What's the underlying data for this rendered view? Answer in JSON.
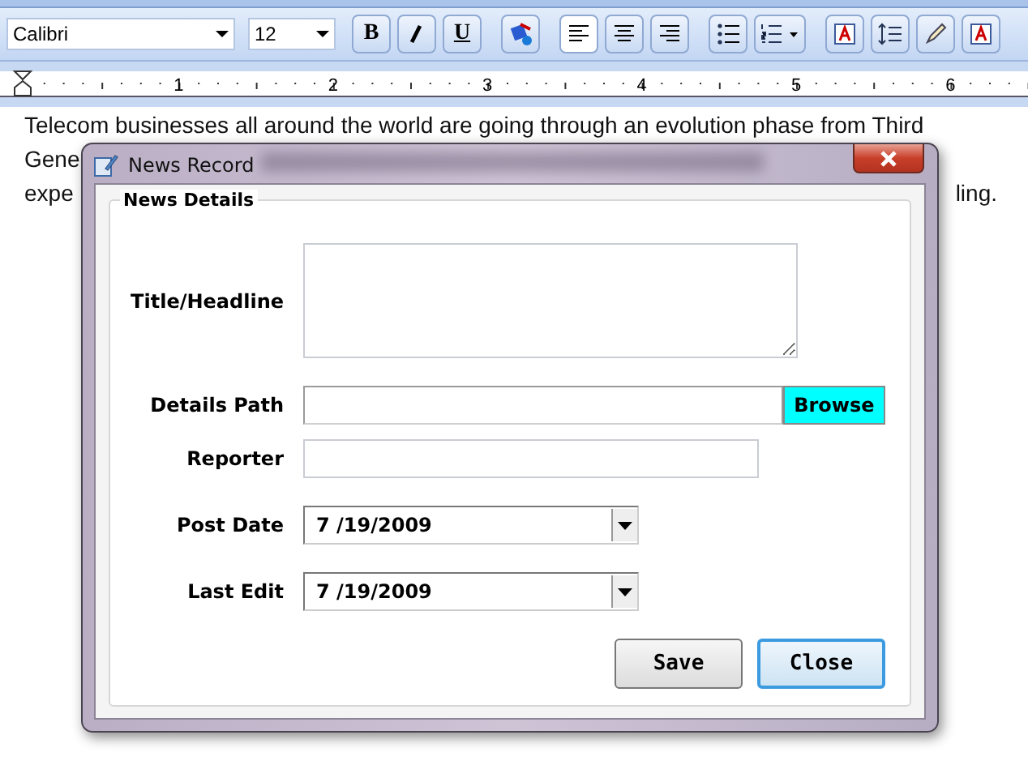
{
  "toolbar": {
    "font_box": "Calibri",
    "size_box": "12",
    "items": [
      {
        "kind": "bold",
        "label": "B",
        "selected": false
      },
      {
        "kind": "italic",
        "selected": false
      },
      {
        "kind": "underline",
        "label": "U",
        "selected": false
      },
      {
        "kind": "paint",
        "selected": false
      },
      {
        "kind": "align-left",
        "selected": true
      },
      {
        "kind": "align-center",
        "selected": false
      },
      {
        "kind": "align-right",
        "selected": false
      },
      {
        "kind": "bullets",
        "selected": false
      },
      {
        "kind": "numbering",
        "selected": false
      },
      {
        "kind": "font-color",
        "selected": false
      },
      {
        "kind": "spacing",
        "selected": false
      },
      {
        "kind": "pencil",
        "selected": false
      },
      {
        "kind": "font-color",
        "selected": false
      }
    ]
  },
  "ruler": {
    "numbers": [
      "1",
      "2",
      "3",
      "4",
      "5",
      "6"
    ]
  },
  "document": {
    "lines": [
      {
        "start": "Telecom businesses all around the world are going through an evolution phase from Third"
      },
      {
        "start": "Gene"
      },
      {
        "start": "expe",
        "end": "ling."
      }
    ]
  },
  "dialog": {
    "title": "News Record",
    "group": "News Details",
    "fields": [
      {
        "kind": "textarea",
        "label": "Title/Headline"
      },
      {
        "kind": "path",
        "label": "Details Path",
        "button": "Browse"
      },
      {
        "kind": "text",
        "label": "Reporter"
      },
      {
        "kind": "date",
        "label": "Post Date",
        "value": "7 /19/2009"
      },
      {
        "kind": "date",
        "label": "Last Edit",
        "value": "7 /19/2009"
      }
    ],
    "buttons": [
      {
        "label": "Save",
        "focused": false
      },
      {
        "label": "Close",
        "focused": true
      }
    ]
  }
}
